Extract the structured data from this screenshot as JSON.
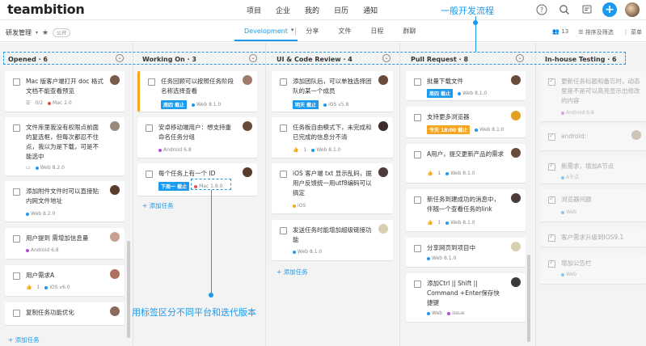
{
  "topbar": {
    "logo": "teambition",
    "nav": [
      "项目",
      "企业",
      "我的",
      "日历",
      "通知"
    ]
  },
  "subbar": {
    "project": "研发管理",
    "public_badge": "公开",
    "tabs": [
      "Development",
      "分享",
      "文件",
      "日程",
      "群聊"
    ],
    "member_count": "13",
    "sort_filter": "排序及筛选",
    "menu": "菜单"
  },
  "columns": [
    {
      "name": "Opened · 6",
      "add_label": "添加任务",
      "cards": [
        {
          "title": "Mac 版客户端打开 doc 格式文档不能查看预览",
          "meta_text": "0/2",
          "tag": "Mac 2.0",
          "tag_color": "#e94d4d"
        },
        {
          "title": "文件库里我没有权限点前面的复选框，但每次都忍不住点，我以为是下载，可是不能选中",
          "tag": "Web 8.2.0",
          "tag_color": "#1b9aee"
        },
        {
          "title": "添加附件文件时可以直接贴内网文件地址",
          "tag": "Web 8.2.0",
          "tag_color": "#1b9aee"
        },
        {
          "title": "用户提到 需增加信息量",
          "tag": "Android 6.8",
          "tag_color": "#b44ad6"
        },
        {
          "title": "用户需求A",
          "likes": "1",
          "tag": "iOS v6.0",
          "tag_color": "#1b9aee"
        },
        {
          "title": "复制任务功能优化",
          "tag": ""
        }
      ]
    },
    {
      "name": "Working On · 3",
      "add_label": "添加任务",
      "cards": [
        {
          "title": "任务回顾可以按照任务阶段名称选择查看",
          "due": "周四 截止",
          "tag": "Web 8.1.0",
          "tag_color": "#1b9aee"
        },
        {
          "title": "安卓移动端用户：想支持重命名任务分组",
          "tag": "Android 6.8",
          "tag_color": "#b44ad6"
        },
        {
          "title": "每个任务上有一个 ID",
          "due": "下周一 截止",
          "tag": "Mac 1.9.0",
          "tag_color": "#e94d4d"
        }
      ]
    },
    {
      "name": "UI & Code Review · 4",
      "add_label": "添加任务",
      "cards": [
        {
          "title": "添加团队后，可以单独选择团队的某一个成员",
          "due": "明天 截止",
          "tag": "iOS v5.8",
          "tag_color": "#1b9aee"
        },
        {
          "title": "任务板自由模式下，未完成和已完成的信息分不清",
          "likes": "1",
          "tag": "Web 8.1.0",
          "tag_color": "#1b9aee"
        },
        {
          "title": "iOS 客户端 txt 显示乱码，据用户反馈统一用utf8编码可以搞定",
          "tag": "iOS",
          "tag_color": "#f5a623"
        },
        {
          "title": "发送任务时能增加超级链接功能",
          "tag": "Web 8.1.0",
          "tag_color": "#1b9aee"
        }
      ]
    },
    {
      "name": "Pull Request · 8",
      "add_label": "",
      "cards": [
        {
          "title": "批量下载文件",
          "due": "周四 截止",
          "tag": "Web 8.1.0",
          "tag_color": "#1b9aee"
        },
        {
          "title": "支持更多浏览器",
          "due": "今天 18:00 截止",
          "due_color": "orange",
          "tag": "Web 8.1.0",
          "tag_color": "#1b9aee"
        },
        {
          "title": "A用户，提交更新产品的需求",
          "likes": "1",
          "tag": "Web 8.1.0",
          "tag_color": "#1b9aee"
        },
        {
          "title": "新任务到建成功的消息中，伴随一个查看任务的link",
          "likes": "1",
          "tag": "Web 8.1.0",
          "tag_color": "#1b9aee"
        },
        {
          "title": "分享网页到项目中",
          "tag": "Web 8.1.0",
          "tag_color": "#1b9aee"
        },
        {
          "title": "添加Ctrl || Shift || Command +Enter保存快捷键",
          "tag": "Web",
          "tag2": "issue",
          "tag_color": "#1b9aee",
          "tag2_color": "#b44ad6"
        }
      ]
    },
    {
      "name": "In-house Testing · 6",
      "add_label": "",
      "cards": [
        {
          "title": "更新任务标题和备忘时，动态里是不是可以高亮显示出修改的内容",
          "tag": "Android 6.8",
          "tag_color": "#b44ad6"
        },
        {
          "title": "android:",
          "tag": ""
        },
        {
          "title": "新需求，增加A节点",
          "tag": "A节点",
          "tag_color": "#1b9aee"
        },
        {
          "title": "浏览器问题",
          "tag": "Web",
          "tag_color": "#1b9aee"
        },
        {
          "title": "客户需求升级到IOS9.1",
          "tag": ""
        },
        {
          "title": "增加公告栏",
          "tag": "Web",
          "tag_color": "#1b9aee"
        }
      ]
    }
  ],
  "annotations": {
    "workflow": "一般开发流程",
    "tags": "用标签区分不同平台和迭代版本"
  }
}
